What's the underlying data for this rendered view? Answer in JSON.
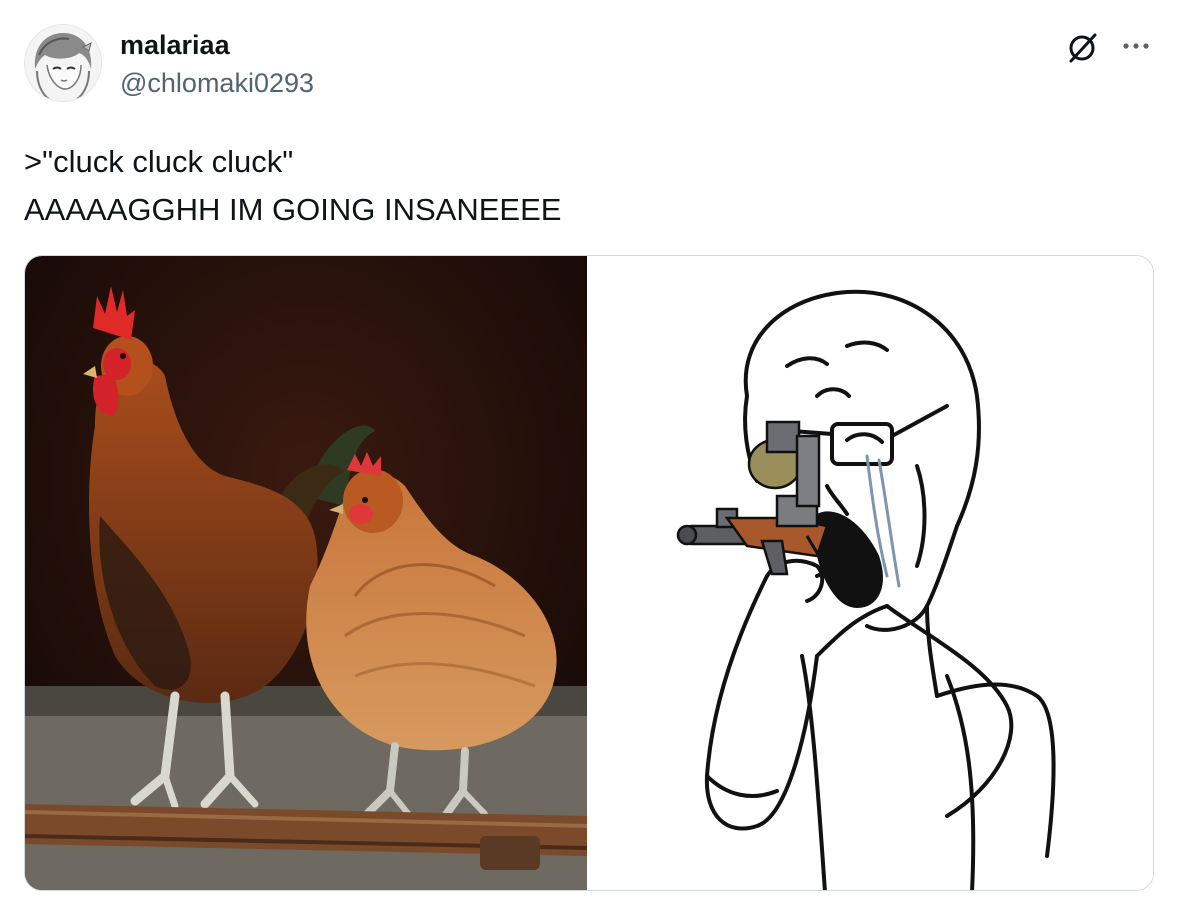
{
  "author": {
    "display_name": "malariaa",
    "handle": "@chlomaki0293",
    "avatar_icon": "avatar-anime-girl-sketch"
  },
  "actions": {
    "grok_icon": "grok-slash-circle-icon",
    "more_icon": "more-dots-icon"
  },
  "tweet": {
    "line1": ">\"cluck cluck cluck\"",
    "line2": "AAAAAGGHH IM GOING INSANEEEE"
  },
  "media": {
    "left_image": "photo of a rooster and a hen perched on a wooden branch",
    "right_image": "crying wojak aiming a rifle"
  },
  "colors": {
    "text": "#0f1419",
    "secondary": "#536471",
    "border": "#cfd9de"
  }
}
